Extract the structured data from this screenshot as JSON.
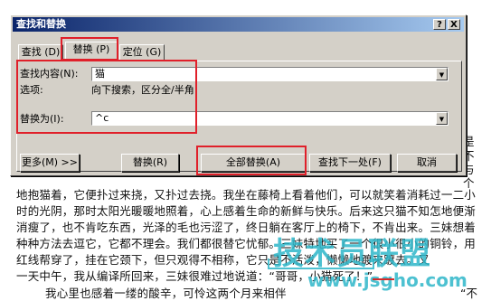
{
  "dialog": {
    "title": "查找和替换",
    "help_label": "?",
    "close_label": "X",
    "tabs": [
      {
        "label": "查找 (D)",
        "active": false
      },
      {
        "label": "替换 (P)",
        "active": true
      },
      {
        "label": "定位 (G)",
        "active": false
      }
    ],
    "find_label": "查找内容(N):",
    "find_value": "猫",
    "options_label": "选项:",
    "options_value": "向下搜索，区分全/半角",
    "replace_label": "替换为(I):",
    "replace_value": "^c",
    "buttons": {
      "more": "更多(M) >>",
      "replace": "替换(R)",
      "replace_all": "全部替换(A)",
      "find_next": "查找下一处(F)",
      "cancel": "取消"
    },
    "dropdown_icon": "chevron-down-icon"
  },
  "document": {
    "lines": [
      "地抱猫着，它便扑过来挠，又扑过去挠。我坐在藤椅上看着他们，可以就笑着消耗过一二小",
      "时的光阴，那时太阳光暖暖地照着，心上感着生命的新鲜与快乐。后来这只猫不知怎地便渐",
      "消瘦了，也不肯吃东西，光泽的毛也污涩了，终日躺在客厅上的椅下，不肯出来。三妹想着",
      "种种方法去逗它，它都不理会。我们都很替它忧郁。三妹特地买了一个很小很小的铜铃，用",
      "红线帮穿了，挂在它颈下，但只观得不相称，它只是不活泼，懒懒地踱来踱去。又",
      "一天中午，我从编译所回来，三妹很难过地说道：“哥哥，小猫死了！”",
      "我心里也感着一缕的酸辛，可怜这两个月来相伴"
    ],
    "right_margin_text": [
      "是",
      "不",
      "与",
      "个",
      "不",
      "便"
    ],
    "last_line_tail": "“不",
    "watermark": "技术员联盟",
    "watermark_url": "www.jsgho.com"
  },
  "colors": {
    "highlight_red": "#e0202a",
    "watermark": "#2fb7c9",
    "dialog_bg": "#d4d0c8"
  }
}
